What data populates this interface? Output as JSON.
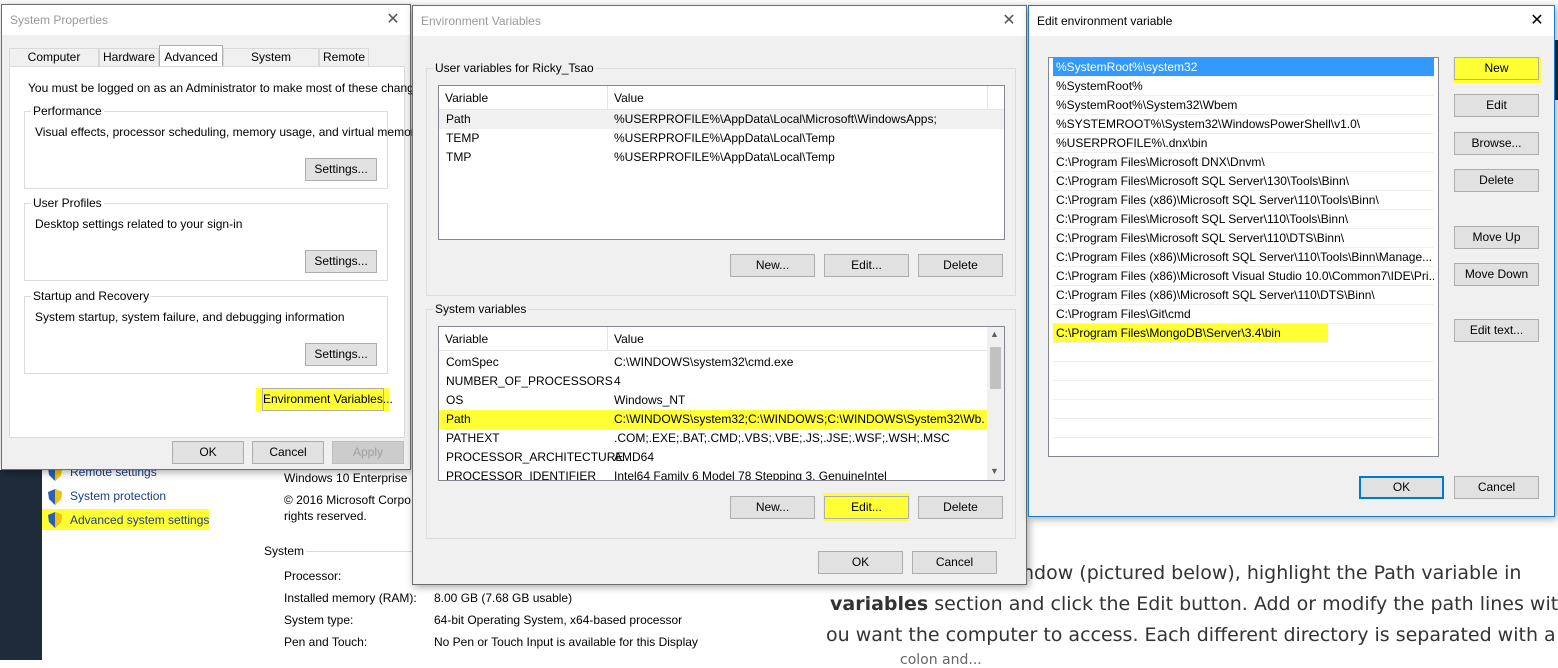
{
  "background_page": {
    "nav_links": [
      "Remote settings",
      "System protection",
      "Advanced system settings"
    ],
    "edition": "Windows 10 Enterprise",
    "copyright": "© 2016 Microsoft Corpo",
    "rights": "rights reserved.",
    "system_heading": "System",
    "specs": [
      {
        "label": "Processor:",
        "value": ""
      },
      {
        "label": "Installed memory (RAM):",
        "value": "8.00 GB (7.68 GB usable)"
      },
      {
        "label": "System type:",
        "value": "64-bit Operating System, x64-based processor"
      },
      {
        "label": "Pen and Touch:",
        "value": "No Pen or Touch Input is available for this Display"
      }
    ],
    "article": {
      "line1": "ndow (pictured below), highlight the Path variable in",
      "line2_bold": "variables",
      "line2_rest": " section and click the Edit button. Add or modify the path lines with",
      "line3": "ou want the computer to access. Each different directory is separated with a",
      "line4": "colon and..."
    }
  },
  "system_properties": {
    "title": "System Properties",
    "tabs": [
      "Computer Name",
      "Hardware",
      "Advanced",
      "System Protection",
      "Remote"
    ],
    "active_tab": "Advanced",
    "admin_note": "You must be logged on as an Administrator to make most of these changes.",
    "performance": {
      "label": "Performance",
      "desc": "Visual effects, processor scheduling, memory usage, and virtual memory",
      "button": "Settings..."
    },
    "user_profiles": {
      "label": "User Profiles",
      "desc": "Desktop settings related to your sign-in",
      "button": "Settings..."
    },
    "startup": {
      "label": "Startup and Recovery",
      "desc": "System startup, system failure, and debugging information",
      "button": "Settings..."
    },
    "env_button": "Environment Variables...",
    "ok": "OK",
    "cancel": "Cancel",
    "apply": "Apply"
  },
  "environment_variables": {
    "title": "Environment Variables",
    "user_label": "User variables for Ricky_Tsao",
    "col_variable": "Variable",
    "col_value": "Value",
    "user_vars": [
      {
        "name": "Path",
        "value": "%USERPROFILE%\\AppData\\Local\\Microsoft\\WindowsApps;"
      },
      {
        "name": "TEMP",
        "value": "%USERPROFILE%\\AppData\\Local\\Temp"
      },
      {
        "name": "TMP",
        "value": "%USERPROFILE%\\AppData\\Local\\Temp"
      }
    ],
    "system_label": "System variables",
    "system_vars": [
      {
        "name": "ComSpec",
        "value": "C:\\WINDOWS\\system32\\cmd.exe"
      },
      {
        "name": "NUMBER_OF_PROCESSORS",
        "value": "4"
      },
      {
        "name": "OS",
        "value": "Windows_NT"
      },
      {
        "name": "Path",
        "value": "C:\\WINDOWS\\system32;C:\\WINDOWS;C:\\WINDOWS\\System32\\Wb..."
      },
      {
        "name": "PATHEXT",
        "value": ".COM;.EXE;.BAT;.CMD;.VBS;.VBE;.JS;.JSE;.WSF;.WSH;.MSC"
      },
      {
        "name": "PROCESSOR_ARCHITECTURE",
        "value": "AMD64"
      },
      {
        "name": "PROCESSOR_IDENTIFIER",
        "value": "Intel64 Family 6 Model 78 Stepping 3, GenuineIntel"
      }
    ],
    "new": "New...",
    "edit": "Edit...",
    "delete": "Delete",
    "ok": "OK",
    "cancel": "Cancel"
  },
  "edit_env_var": {
    "title": "Edit environment variable",
    "items": [
      "%SystemRoot%\\system32",
      "%SystemRoot%",
      "%SystemRoot%\\System32\\Wbem",
      "%SYSTEMROOT%\\System32\\WindowsPowerShell\\v1.0\\",
      "%USERPROFILE%\\.dnx\\bin",
      "C:\\Program Files\\Microsoft DNX\\Dnvm\\",
      "C:\\Program Files\\Microsoft SQL Server\\130\\Tools\\Binn\\",
      "C:\\Program Files (x86)\\Microsoft SQL Server\\110\\Tools\\Binn\\",
      "C:\\Program Files\\Microsoft SQL Server\\110\\Tools\\Binn\\",
      "C:\\Program Files\\Microsoft SQL Server\\110\\DTS\\Binn\\",
      "C:\\Program Files (x86)\\Microsoft SQL Server\\110\\Tools\\Binn\\Manage...",
      "C:\\Program Files (x86)\\Microsoft Visual Studio 10.0\\Common7\\IDE\\Pri...",
      "C:\\Program Files (x86)\\Microsoft SQL Server\\110\\DTS\\Binn\\",
      "C:\\Program Files\\Git\\cmd",
      "C:\\Program Files\\MongoDB\\Server\\3.4\\bin"
    ],
    "buttons": {
      "new": "New",
      "edit": "Edit",
      "browse": "Browse...",
      "delete": "Delete",
      "move_up": "Move Up",
      "move_down": "Move Down",
      "edit_text": "Edit text..."
    },
    "ok": "OK",
    "cancel": "Cancel"
  },
  "colors": {
    "highlight": "#ffff33",
    "selection": "#3399ff",
    "accent": "#0078d7"
  }
}
